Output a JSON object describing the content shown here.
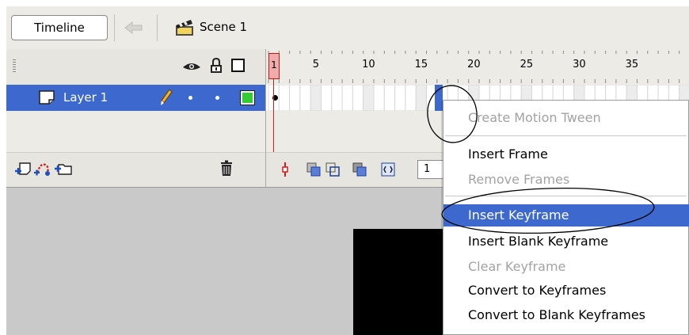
{
  "toolbar": {
    "timeline_tab": "Timeline",
    "scene_label": "Scene 1"
  },
  "layers": [
    {
      "name": "Layer 1",
      "selected": true,
      "outline_color": "#33cc33"
    }
  ],
  "frame_ruler": {
    "playhead_frame": "1",
    "labels": [
      "5",
      "10",
      "15",
      "20",
      "25",
      "30",
      "35"
    ]
  },
  "frame_footer": {
    "current_frame": "1"
  },
  "context_menu": {
    "items": [
      {
        "label": "Create Motion Tween",
        "enabled": false
      },
      {
        "label": "Insert Frame",
        "enabled": true
      },
      {
        "label": "Remove Frames",
        "enabled": false
      },
      {
        "label": "Insert Keyframe",
        "enabled": true,
        "highlighted": true
      },
      {
        "label": "Insert Blank Keyframe",
        "enabled": true
      },
      {
        "label": "Clear Keyframe",
        "enabled": false
      },
      {
        "label": "Convert to Keyframes",
        "enabled": true
      },
      {
        "label": "Convert to Blank Keyframes",
        "enabled": true
      }
    ]
  },
  "colors": {
    "selection_blue": "#3d69cf",
    "playhead_red": "#d41c1c",
    "panel_gray": "#ecebe6",
    "stage_gray": "#c9c9c9"
  }
}
